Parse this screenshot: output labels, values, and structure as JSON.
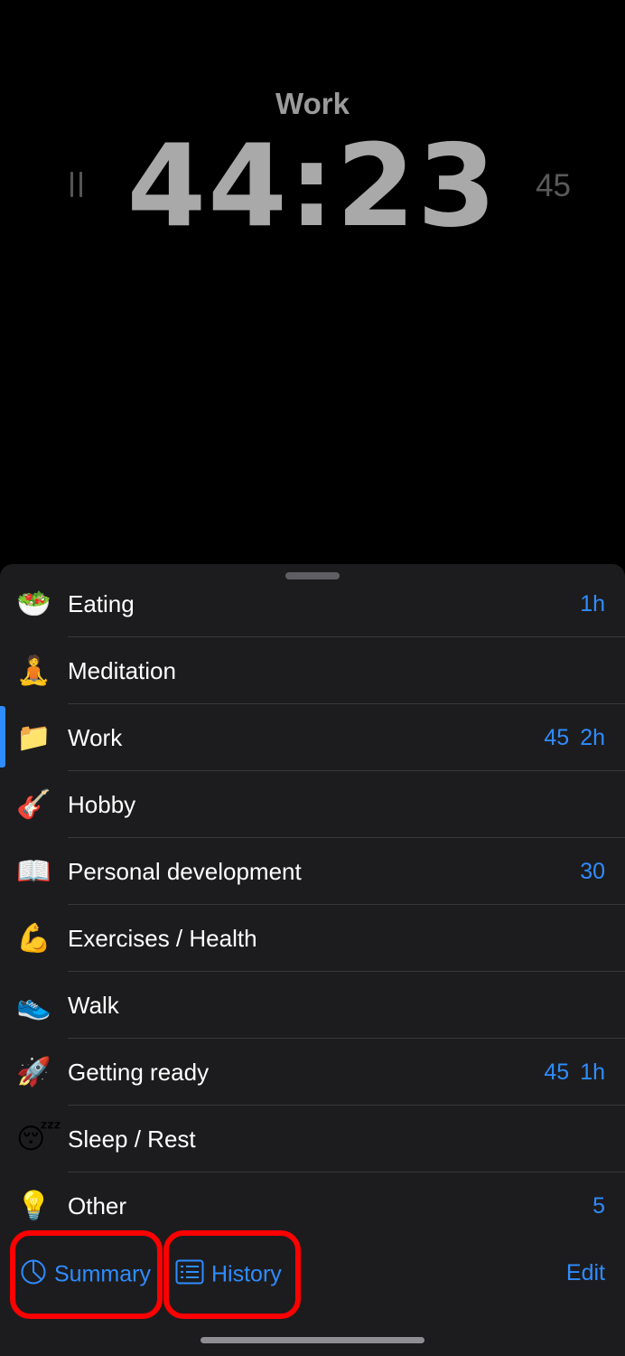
{
  "timer": {
    "activity": "Work",
    "elapsed": "44:23",
    "target": "45"
  },
  "activities": [
    {
      "emoji": "🥗",
      "icon": "salad-icon",
      "label": "Eating",
      "stats": [
        "1h"
      ]
    },
    {
      "emoji": "🧘",
      "icon": "meditation-icon",
      "label": "Meditation",
      "stats": []
    },
    {
      "emoji": "📁",
      "icon": "folder-icon",
      "label": "Work",
      "stats": [
        "45",
        "2h"
      ],
      "active": true
    },
    {
      "emoji": "🎸",
      "icon": "guitar-icon",
      "label": "Hobby",
      "stats": []
    },
    {
      "emoji": "📖",
      "icon": "book-icon",
      "label": "Personal development",
      "stats": [
        "30"
      ]
    },
    {
      "emoji": "💪",
      "icon": "flexed-biceps-icon",
      "label": "Exercises / Health",
      "stats": []
    },
    {
      "emoji": "👟",
      "icon": "sneaker-icon",
      "label": "Walk",
      "stats": []
    },
    {
      "emoji": "🚀",
      "icon": "rocket-icon",
      "label": "Getting ready",
      "stats": [
        "45",
        "1h"
      ]
    },
    {
      "emoji": "😴",
      "icon": "sleeping-face-icon",
      "label": "Sleep / Rest",
      "stats": []
    },
    {
      "emoji": "💡",
      "icon": "light-bulb-icon",
      "label": "Other",
      "stats": [
        "5"
      ]
    }
  ],
  "toolbar": {
    "summary_label": "Summary",
    "history_label": "History",
    "edit_label": "Edit"
  },
  "colors": {
    "accent": "#2f8cff",
    "sheet_background": "#1c1c1e",
    "highlight": "#ff0000"
  }
}
